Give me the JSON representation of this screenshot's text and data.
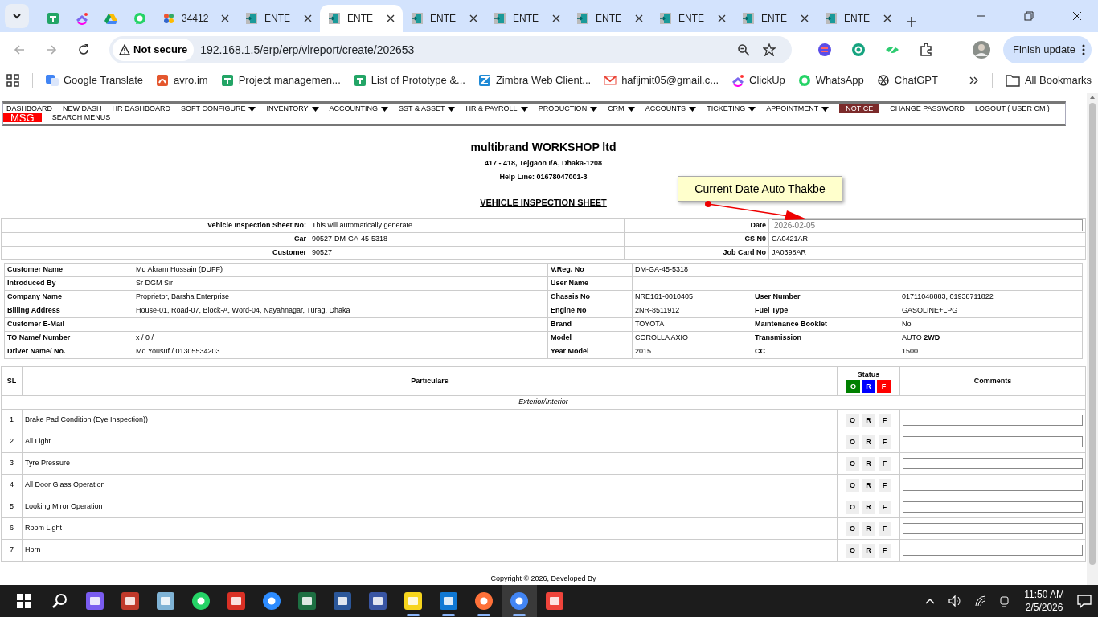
{
  "tabs": [
    {
      "kind": "sheets",
      "selected": false
    },
    {
      "kind": "clickup",
      "selected": false
    },
    {
      "kind": "drive",
      "selected": false
    },
    {
      "kind": "whatsapp",
      "selected": false
    },
    {
      "kind": "pinwheel",
      "title": "34412",
      "selected": false
    },
    {
      "kind": "enter",
      "title": "ENTE",
      "selected": false
    },
    {
      "kind": "enter",
      "title": "ENTE",
      "selected": true
    },
    {
      "kind": "enter",
      "title": "ENTE",
      "selected": false
    },
    {
      "kind": "enter",
      "title": "ENTE",
      "selected": false
    },
    {
      "kind": "enter",
      "title": "ENTE",
      "selected": false
    },
    {
      "kind": "enter",
      "title": "ENTE",
      "selected": false
    },
    {
      "kind": "enter",
      "title": "ENTE",
      "selected": false
    },
    {
      "kind": "enter",
      "title": "ENTE",
      "selected": false
    }
  ],
  "address": {
    "security": "Not secure",
    "url": "192.168.1.5/erp/erp/vlreport/create/202653"
  },
  "update_button": "Finish update",
  "bookmarks": [
    {
      "kind": "translate",
      "label": "Google Translate"
    },
    {
      "kind": "avro",
      "label": "avro.im"
    },
    {
      "kind": "sheets",
      "label": "Project managemen..."
    },
    {
      "kind": "sheets",
      "label": "List of Prototype &..."
    },
    {
      "kind": "zimbra",
      "label": "Zimbra Web Client..."
    },
    {
      "kind": "gmail",
      "label": "hafijmit05@gmail.c..."
    },
    {
      "kind": "clickup",
      "label": "ClickUp"
    },
    {
      "kind": "whatsapp",
      "label": "WhatsApp"
    },
    {
      "kind": "chatgpt",
      "label": "ChatGPT"
    }
  ],
  "all_bookmarks": "All Bookmarks",
  "menu": [
    {
      "label": "DASHBOARD",
      "kind": "plain",
      "dropdown": false
    },
    {
      "label": "NEW DASH",
      "kind": "plain",
      "dropdown": false
    },
    {
      "label": "HR DASHBOARD",
      "kind": "plain",
      "dropdown": false
    },
    {
      "label": "SOFT CONFIGURE",
      "kind": "plain",
      "dropdown": true
    },
    {
      "label": "INVENTORY",
      "kind": "plain",
      "dropdown": true
    },
    {
      "label": "ACCOUNTING",
      "kind": "plain",
      "dropdown": true
    },
    {
      "label": "SST & ASSET",
      "kind": "plain",
      "dropdown": true
    },
    {
      "label": "HR & PAYROLL",
      "kind": "plain",
      "dropdown": true
    },
    {
      "label": "PRODUCTION",
      "kind": "plain",
      "dropdown": true
    },
    {
      "label": "CRM",
      "kind": "plain",
      "dropdown": true
    },
    {
      "label": "ACCOUNTS",
      "kind": "plain",
      "dropdown": true
    },
    {
      "label": "TICKETING",
      "kind": "plain",
      "dropdown": true
    },
    {
      "label": "APPOINTMENT",
      "kind": "plain",
      "dropdown": true
    },
    {
      "label": "NOTICE",
      "kind": "notice",
      "dropdown": false
    },
    {
      "label": "CHANGE PASSWORD",
      "kind": "plain",
      "dropdown": false
    },
    {
      "label": "LOGOUT ( USER CM )",
      "kind": "plain",
      "dropdown": false
    },
    {
      "label": "MSG",
      "kind": "msg",
      "dropdown": false
    },
    {
      "label": "SEARCH MENUS",
      "kind": "plain",
      "dropdown": false
    }
  ],
  "company": {
    "name": "multibrand WORKSHOP ltd",
    "address": "417 - 418, Tejgaon I/A, Dhaka-1208",
    "helpline": "Help Line: 01678047001-3"
  },
  "sheet_title": "VEHICLE INSPECTION SHEET",
  "callout": "Current Date Auto Thakbe",
  "header_rows": [
    {
      "left": {
        "label": "Vehicle Inspection Sheet No:",
        "value": "This will automatically generate"
      },
      "right": {
        "label": "Date",
        "kind": "input",
        "placeholder": "2026-02-05"
      }
    },
    {
      "left": {
        "label": "Car",
        "value": "90527-DM-GA-45-5318"
      },
      "right": {
        "label": "CS N0",
        "kind": "text",
        "value": "CA0421AR"
      }
    },
    {
      "left": {
        "label": "Customer",
        "value": "90527"
      },
      "right": {
        "label": "Job Card No",
        "kind": "text",
        "value": "JA0398AR"
      }
    }
  ],
  "details": [
    [
      {
        "label": "Customer Name",
        "value": "Md Akram Hossain (DUFF)"
      },
      {
        "label": "V.Reg. No",
        "value": "DM-GA-45-5318"
      }
    ],
    [
      {
        "label": "Introduced By",
        "value": "Sr DGM Sir"
      },
      {
        "label": "User Name"
      }
    ],
    [
      {
        "label": "Company Name",
        "value": "Proprietor, Barsha Enterprise"
      },
      {
        "label": "Chassis No",
        "value": "NRE161-0010405"
      },
      {
        "label": "User Number",
        "value": "01711048883, 01938711822"
      }
    ],
    [
      {
        "label": "Billing Address",
        "value": "House-01, Road-07, Block-A, Word-04, Nayahnagar, Turag, Dhaka"
      },
      {
        "label": "Engine No",
        "value": "2NR-8511912"
      },
      {
        "label": "Fuel Type",
        "value": "GASOLINE+LPG"
      }
    ],
    [
      {
        "label": "Customer E-Mail"
      },
      {
        "label": "Brand",
        "value": "TOYOTA"
      },
      {
        "label": "Maintenance Booklet",
        "value": "No"
      }
    ],
    [
      {
        "label": "TO Name/ Number",
        "value": "x / 0 /"
      },
      {
        "label": "Model",
        "value": "COROLLA AXIO"
      },
      {
        "label": "Transmission",
        "value": "AUTO **2WD**"
      }
    ],
    [
      {
        "label": "Driver Name/ No.",
        "value": "Md Yousuf / 01305534203"
      },
      {
        "label": "Year Model",
        "value": "2015"
      },
      {
        "label": "CC",
        "value": "1500"
      }
    ]
  ],
  "checklist": {
    "columns": {
      "sl": "SL",
      "particulars": "Particulars",
      "status": "Status",
      "comments": "Comments"
    },
    "legend": [
      {
        "letter": "O",
        "color": "#008000"
      },
      {
        "letter": "R",
        "color": "#0000ff"
      },
      {
        "letter": "F",
        "color": "#ff0000"
      }
    ],
    "section": "Exterior/Interior",
    "items": [
      {
        "sl": "1",
        "particular": "Brake Pad Condition (Eye Inspection))",
        "options": [
          "O",
          "R",
          "F"
        ]
      },
      {
        "sl": "2",
        "particular": "All Light",
        "options": [
          "O",
          "R",
          "F"
        ]
      },
      {
        "sl": "3",
        "particular": "Tyre Pressure",
        "options": [
          "O",
          "R",
          "F"
        ]
      },
      {
        "sl": "4",
        "particular": "All Door Glass Operation",
        "options": [
          "O",
          "R",
          "F"
        ]
      },
      {
        "sl": "5",
        "particular": "Looking Miror Operation",
        "options": [
          "O",
          "R",
          "F"
        ]
      },
      {
        "sl": "6",
        "particular": "Room Light",
        "options": [
          "O",
          "R",
          "F"
        ]
      },
      {
        "sl": "7",
        "particular": "Horn",
        "options": [
          "O",
          "R",
          "F"
        ]
      }
    ]
  },
  "footer": "Copyright © 2026, Developed By",
  "taskbar": {
    "apps": [
      {
        "kind": "copilot",
        "running": false,
        "active": false
      },
      {
        "kind": "avro",
        "running": false,
        "active": false
      },
      {
        "kind": "notepad",
        "running": false,
        "active": false
      },
      {
        "kind": "whatsapp",
        "running": false,
        "active": false
      },
      {
        "kind": "acrobat",
        "running": false,
        "active": false
      },
      {
        "kind": "zoom",
        "running": false,
        "active": false
      },
      {
        "kind": "excel",
        "running": false,
        "active": false
      },
      {
        "kind": "word",
        "running": false,
        "active": false
      },
      {
        "kind": "visio",
        "running": false,
        "active": false
      },
      {
        "kind": "sticky",
        "running": true,
        "active": false
      },
      {
        "kind": "skype",
        "running": true,
        "active": false
      },
      {
        "kind": "firefox",
        "running": true,
        "active": false
      },
      {
        "kind": "chrome",
        "running": true,
        "active": true
      },
      {
        "kind": "anydesk",
        "running": false,
        "active": false
      }
    ],
    "time": "11:50 AM",
    "date": "2/5/2026"
  }
}
